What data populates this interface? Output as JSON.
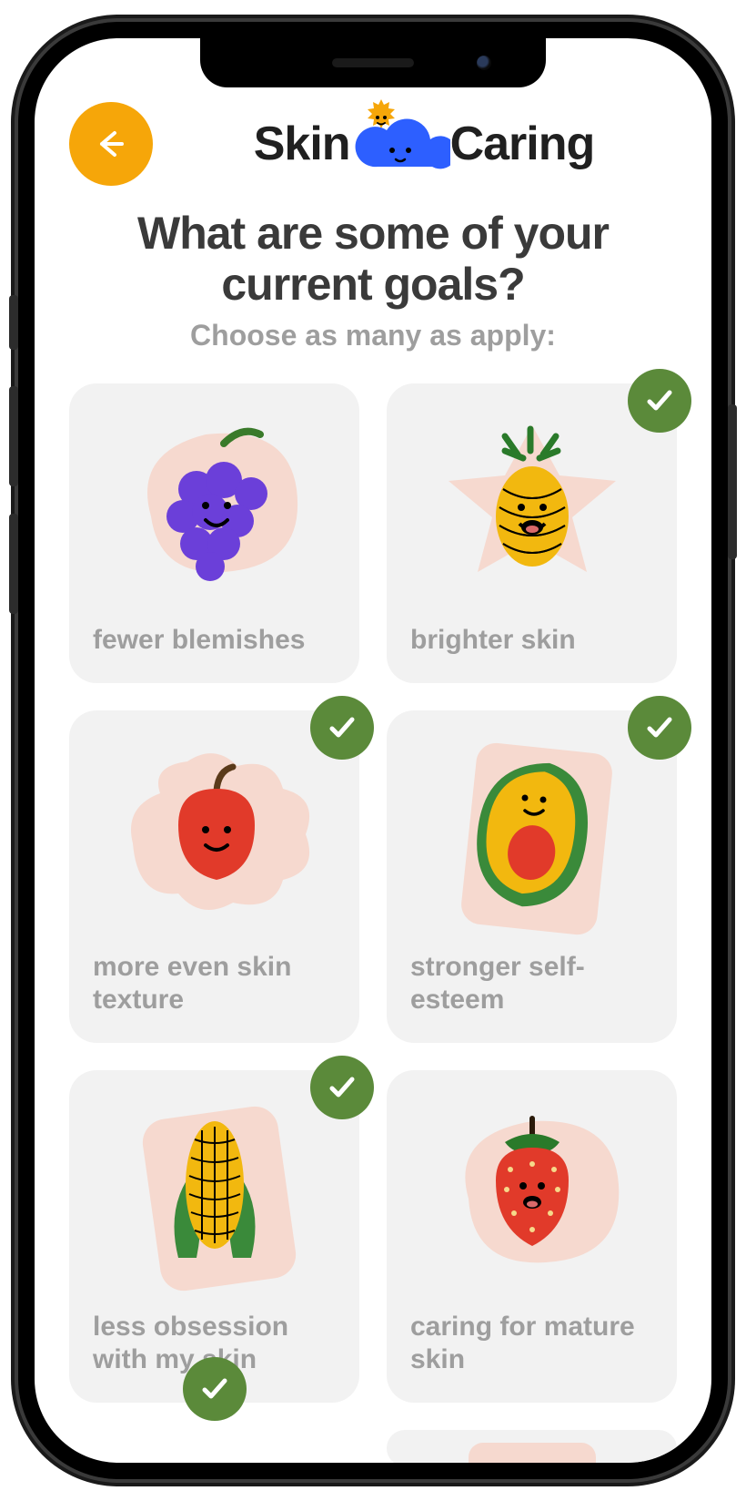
{
  "app": {
    "name_part1": "Skin",
    "name_part2": "Caring"
  },
  "colors": {
    "accent_orange": "#f6a609",
    "check_green": "#5b8a3a",
    "card_bg": "#f2f2f2",
    "peach": "#f6d9cf",
    "text_dark": "#3a3a3a",
    "text_muted": "#9e9e9e"
  },
  "question": "What are some of your current goals?",
  "subtext": "Choose as many as apply:",
  "goals": [
    {
      "id": "fewer-blemishes",
      "label": "fewer blemishes",
      "selected": false,
      "icon": "grapes"
    },
    {
      "id": "brighter-skin",
      "label": "brighter skin",
      "selected": true,
      "icon": "pineapple"
    },
    {
      "id": "even-texture",
      "label": "more even skin texture",
      "selected": true,
      "icon": "apple"
    },
    {
      "id": "self-esteem",
      "label": "stronger self-esteem",
      "selected": true,
      "icon": "avocado"
    },
    {
      "id": "less-obsession",
      "label": "less obsession with my skin",
      "selected": true,
      "icon": "corn"
    },
    {
      "id": "mature-skin",
      "label": "caring for mature skin",
      "selected": false,
      "icon": "strawberry"
    }
  ]
}
